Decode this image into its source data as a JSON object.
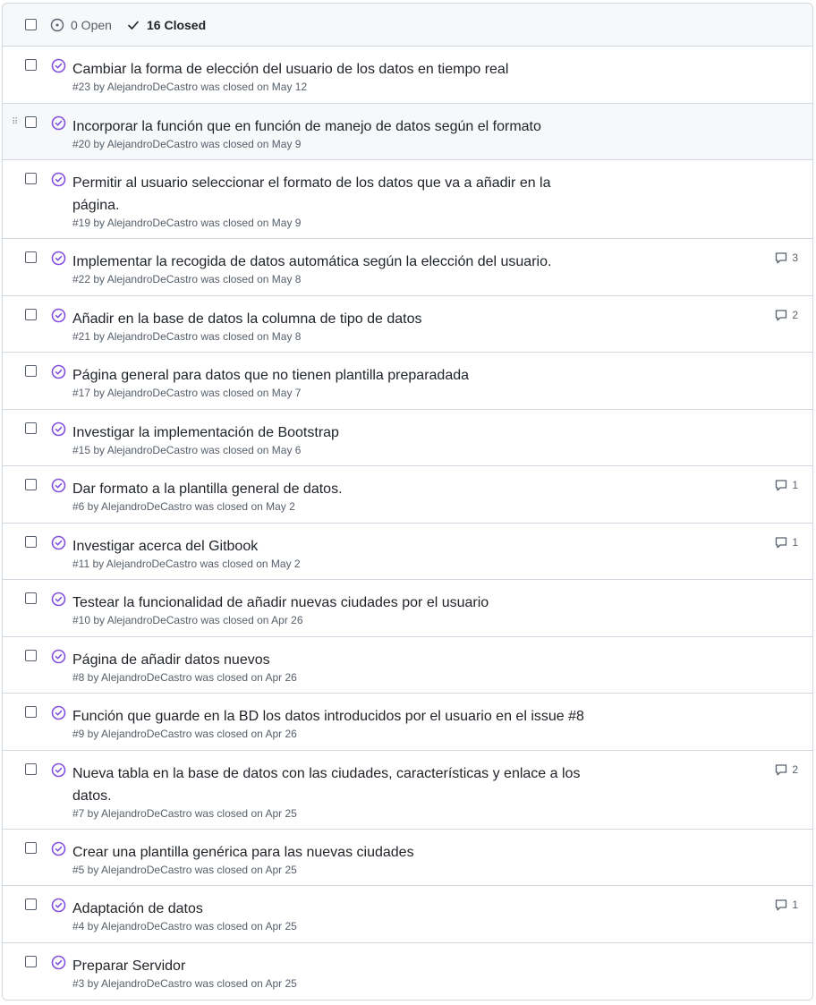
{
  "header": {
    "open_label": "0 Open",
    "closed_label": "16 Closed"
  },
  "colors": {
    "closed_purple": "#8250df",
    "border": "#d0d7de",
    "muted": "#57606a"
  },
  "issues": [
    {
      "title": "Cambiar la forma de elección del usuario de los datos en tiempo real",
      "meta": "#23 by AlejandroDeCastro was closed on May 12",
      "comments": ""
    },
    {
      "title": "Incorporar la función que en función de manejo de datos según el formato",
      "meta": "#20 by AlejandroDeCastro was closed on May 9",
      "comments": ""
    },
    {
      "title": "Permitir al usuario seleccionar el formato de los datos que va a añadir en la página.",
      "meta": "#19 by AlejandroDeCastro was closed on May 9",
      "comments": ""
    },
    {
      "title": "Implementar la recogida de datos automática según la elección del usuario.",
      "meta": "#22 by AlejandroDeCastro was closed on May 8",
      "comments": "3"
    },
    {
      "title": "Añadir en la base de datos la columna de tipo de datos",
      "meta": "#21 by AlejandroDeCastro was closed on May 8",
      "comments": "2"
    },
    {
      "title": "Página general para datos que no tienen plantilla preparadada",
      "meta": "#17 by AlejandroDeCastro was closed on May 7",
      "comments": ""
    },
    {
      "title": "Investigar la implementación de Bootstrap",
      "meta": "#15 by AlejandroDeCastro was closed on May 6",
      "comments": ""
    },
    {
      "title": "Dar formato a la plantilla general de datos.",
      "meta": "#6 by AlejandroDeCastro was closed on May 2",
      "comments": "1"
    },
    {
      "title": "Investigar acerca del Gitbook",
      "meta": "#11 by AlejandroDeCastro was closed on May 2",
      "comments": "1"
    },
    {
      "title": "Testear la funcionalidad de añadir nuevas ciudades por el usuario",
      "meta": "#10 by AlejandroDeCastro was closed on Apr 26",
      "comments": ""
    },
    {
      "title": "Página de añadir datos nuevos",
      "meta": "#8 by AlejandroDeCastro was closed on Apr 26",
      "comments": ""
    },
    {
      "title": "Función que guarde en la BD los datos introducidos por el usuario en el issue #8",
      "meta": "#9 by AlejandroDeCastro was closed on Apr 26",
      "comments": ""
    },
    {
      "title": "Nueva tabla en la base de datos con las ciudades, características y enlace a los datos.",
      "meta": "#7 by AlejandroDeCastro was closed on Apr 25",
      "comments": "2"
    },
    {
      "title": "Crear una plantilla genérica para las nuevas ciudades",
      "meta": "#5 by AlejandroDeCastro was closed on Apr 25",
      "comments": ""
    },
    {
      "title": "Adaptación de datos",
      "meta": "#4 by AlejandroDeCastro was closed on Apr 25",
      "comments": "1"
    },
    {
      "title": "Preparar Servidor",
      "meta": "#3 by AlejandroDeCastro was closed on Apr 25",
      "comments": ""
    }
  ]
}
